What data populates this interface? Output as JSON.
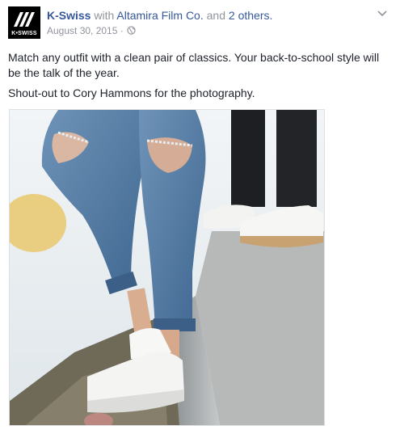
{
  "post": {
    "author": "K-Swiss",
    "with_word": "with",
    "tagged_page": "Altamira Film Co.",
    "and_word": "and",
    "others": "2 others.",
    "date": "August 30, 2015",
    "separator": "·",
    "privacy_icon": "globe-icon",
    "avatar_text": "K•SWISS",
    "message_line1": "Match any outfit with a clean pair of classics. Your back-to-school style will be the talk of the year.",
    "message_line2": "Shout-out to Cory Hammons for the photography."
  },
  "colors": {
    "link": "#365899",
    "muted": "#90949c",
    "text": "#1d2129"
  }
}
